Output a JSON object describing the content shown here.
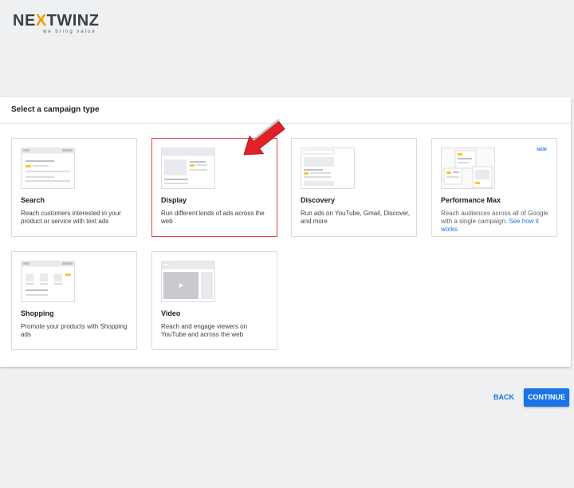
{
  "brand": {
    "logo_pre": "NE",
    "logo_x": "X",
    "logo_post": "TWINZ",
    "tagline": "we bring value"
  },
  "panel": {
    "title": "Select a campaign type"
  },
  "campaign_types": [
    {
      "title": "Search",
      "description": "Reach customers interested in your product or service with text ads",
      "icon": "search-ad-illustration"
    },
    {
      "title": "Display",
      "description": "Run different kinds of ads across the web",
      "icon": "display-ad-illustration",
      "selected": true
    },
    {
      "title": "Discovery",
      "description": "Run ads on YouTube, Gmail, Discover, and more",
      "icon": "discovery-ad-illustration"
    },
    {
      "title": "Performance Max",
      "description": "Reach audiences across all of Google with a single campaign.",
      "link": "See how it works",
      "badge": "NEW",
      "icon": "performance-max-illustration"
    },
    {
      "title": "Shopping",
      "description": "Promote your products with Shopping ads",
      "icon": "shopping-ad-illustration"
    },
    {
      "title": "Video",
      "description": "Reach and engage viewers on YouTube and across the web",
      "icon": "video-ad-illustration"
    }
  ],
  "actions": {
    "back": "BACK",
    "continue": "CONTINUE"
  },
  "colors": {
    "accent": "#1a73e8",
    "selected_border": "#e8434a",
    "highlight": "#f9c735",
    "annotation_arrow": "#e12127"
  }
}
